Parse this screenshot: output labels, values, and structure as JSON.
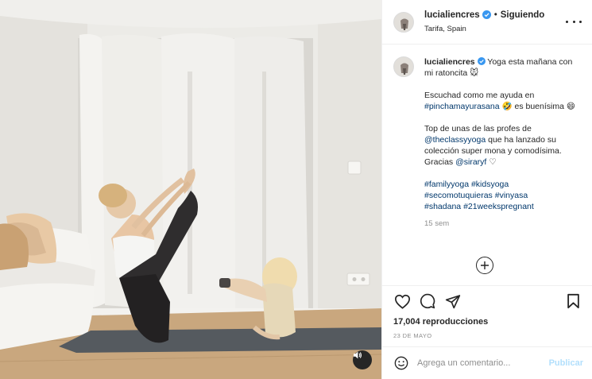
{
  "post": {
    "username": "lucialiencres",
    "verified": true,
    "following_label": "Siguiendo",
    "separator": "•",
    "location": "Tarifa, Spain",
    "caption": {
      "line1": "Yoga esta mañana con mi ratoncita",
      "line1_emoji": "🐭",
      "p2_text": "Escuchad como me ayuda en ",
      "p2_tag": "#pinchamayurasana",
      "p2_emoji": "🤣",
      "p2_end": " es buenísima",
      "p2_emoji2": "😄",
      "p3_text": "Top de unas de las profes de ",
      "p3_tag": "@theclassyyoga",
      "p3_mid": " que ha lanzado su colección super mona y comodísima. Gracias ",
      "p3_tag2": "@siraryf",
      "p3_heart": "♡",
      "hashtags": [
        "#familyyoga",
        "#kidsyoga",
        "#secomotuquieras",
        "#vinyasa",
        "#shadana",
        "#21weekspregnant"
      ]
    },
    "time_ago": "15 sem",
    "views": "17,004 reproducciones",
    "date": "23 DE MAYO"
  },
  "comment_box": {
    "placeholder": "Agrega un comentario...",
    "publish_label": "Publicar"
  },
  "icons": {
    "verified": "verified-badge-icon",
    "more": "more-options-icon",
    "like": "heart-icon",
    "comment": "comment-icon",
    "share": "share-icon",
    "save": "bookmark-icon",
    "load_more": "plus-circle-icon",
    "emoji": "emoji-icon",
    "sound": "speaker-icon"
  },
  "colors": {
    "link": "#00376b",
    "verified": "#3897f0",
    "publish_disabled": "#b2dffc",
    "muted": "#8e8e8e"
  }
}
